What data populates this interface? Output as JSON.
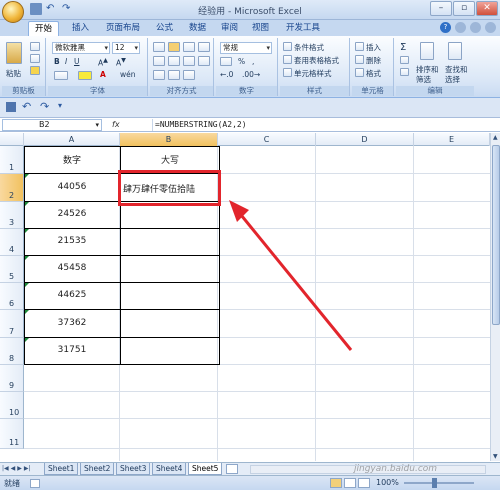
{
  "window": {
    "title": "经验用 - Microsoft Excel",
    "controls": [
      "–",
      "▫",
      "✕"
    ]
  },
  "tabs": [
    "开始",
    "插入",
    "页面布局",
    "公式",
    "数据",
    "审阅",
    "视图",
    "开发工具"
  ],
  "ribbon": {
    "clipboard": {
      "paste": "粘贴",
      "label": "剪贴板"
    },
    "font": {
      "name": "微软雅黑",
      "size": "12",
      "label": "字体"
    },
    "alignment": {
      "label": "对齐方式"
    },
    "number": {
      "format": "常规",
      "label": "数字"
    },
    "styles": {
      "conditional": "条件格式",
      "table": "套用表格格式",
      "cell": "单元格样式",
      "label": "样式"
    },
    "cells": {
      "insert": "插入",
      "delete": "删除",
      "format": "格式",
      "label": "单元格"
    },
    "editing": {
      "sort": "排序和",
      "filter": "筛选",
      "find": "查找和",
      "select": "选择",
      "label": "编辑"
    }
  },
  "formula_bar": {
    "cell_ref": "B2",
    "fx": "fx",
    "formula": "=NUMBERSTRING(A2,2)"
  },
  "columns": [
    "A",
    "B",
    "C",
    "D",
    "E"
  ],
  "rows": [
    "1",
    "2",
    "3",
    "4",
    "5",
    "6",
    "7",
    "8",
    "9",
    "10",
    "11"
  ],
  "table": {
    "headers": [
      "数字",
      "大写"
    ],
    "numbers": [
      "44056",
      "24526",
      "21535",
      "45458",
      "44625",
      "37362",
      "31751"
    ],
    "b2_value": "肆万肆仟零伍拾陆"
  },
  "sheets": [
    "Sheet1",
    "Sheet2",
    "Sheet3",
    "Sheet4",
    "Sheet5"
  ],
  "active_sheet": "Sheet5",
  "status": {
    "ready": "就绪",
    "zoom": "100%"
  },
  "watermark": "jingyan.baidu.com",
  "colors": {
    "highlight": "#e2252c",
    "ribbon": "#dce8f7"
  }
}
